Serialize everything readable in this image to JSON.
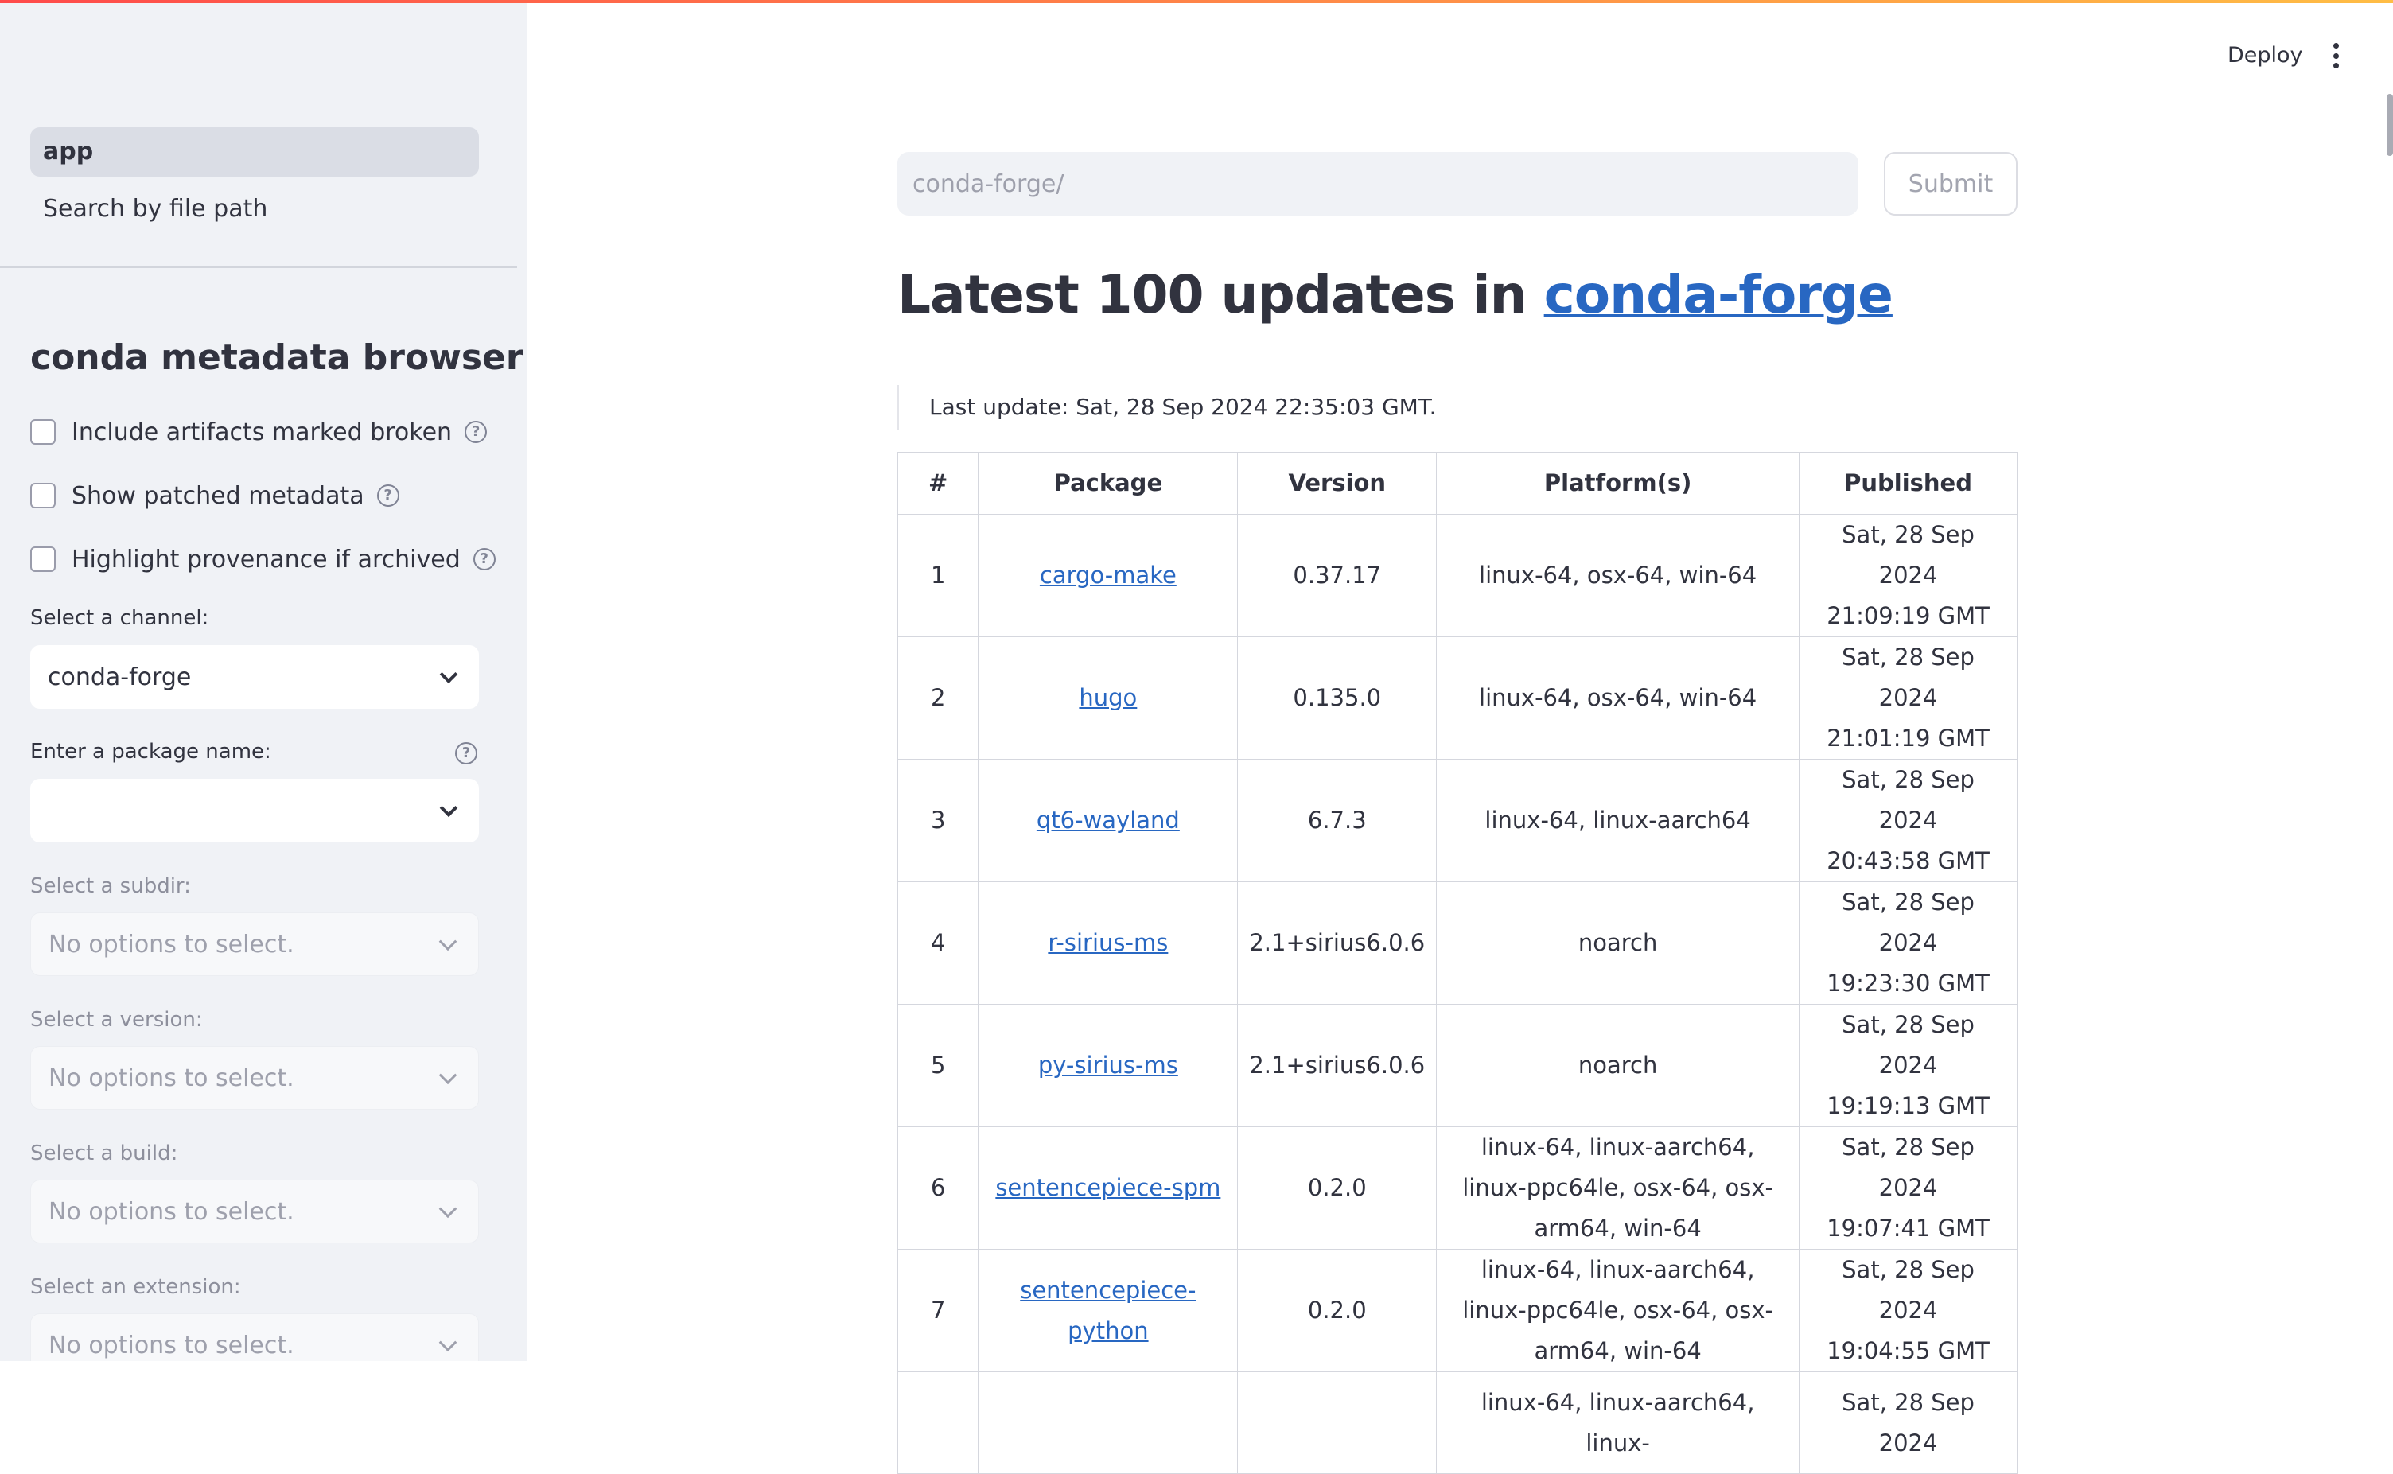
{
  "sidebar": {
    "nav": [
      {
        "label": "app",
        "active": true
      },
      {
        "label": "Search by file path",
        "active": false
      }
    ],
    "title": "conda metadata browser",
    "checkboxes": [
      {
        "label": "Include artifacts marked broken",
        "checked": false
      },
      {
        "label": "Show patched metadata",
        "checked": false
      },
      {
        "label": "Highlight provenance if archived",
        "checked": false
      }
    ],
    "channel": {
      "label": "Select a channel:",
      "value": "conda-forge"
    },
    "package": {
      "label": "Enter a package name:",
      "value": ""
    },
    "subdir": {
      "label": "Select a subdir:",
      "value": "No options to select."
    },
    "version": {
      "label": "Select a version:",
      "value": "No options to select."
    },
    "build": {
      "label": "Select a build:",
      "value": "No options to select."
    },
    "extension": {
      "label": "Select an extension:",
      "value": "No options to select."
    }
  },
  "header": {
    "deploy_label": "Deploy",
    "menu_icon": "kebab-menu-icon"
  },
  "main": {
    "search": {
      "placeholder": "conda-forge/",
      "value": ""
    },
    "submit_label": "Submit",
    "heading_prefix": "Latest 100 updates in",
    "heading_link": "conda-forge",
    "last_update": "Last update: Sat, 28 Sep 2024 22:35:03 GMT.",
    "table": {
      "columns": [
        "#",
        "Package",
        "Version",
        "Platform(s)",
        "Published"
      ],
      "rows": [
        {
          "num": "1",
          "package": "cargo-make",
          "version": "0.37.17",
          "platforms": "linux-64, osx-64, win-64",
          "published_date": "Sat, 28 Sep 2024",
          "published_time": "21:09:19 GMT"
        },
        {
          "num": "2",
          "package": "hugo",
          "version": "0.135.0",
          "platforms": "linux-64, osx-64, win-64",
          "published_date": "Sat, 28 Sep 2024",
          "published_time": "21:01:19 GMT"
        },
        {
          "num": "3",
          "package": "qt6-wayland",
          "version": "6.7.3",
          "platforms": "linux-64, linux-aarch64",
          "published_date": "Sat, 28 Sep 2024",
          "published_time": "20:43:58 GMT"
        },
        {
          "num": "4",
          "package": "r-sirius-ms",
          "version": "2.1+sirius6.0.6",
          "platforms": "noarch",
          "published_date": "Sat, 28 Sep 2024",
          "published_time": "19:23:30 GMT"
        },
        {
          "num": "5",
          "package": "py-sirius-ms",
          "version": "2.1+sirius6.0.6",
          "platforms": "noarch",
          "published_date": "Sat, 28 Sep 2024",
          "published_time": "19:19:13 GMT"
        },
        {
          "num": "6",
          "package": "sentencepiece-spm",
          "version": "0.2.0",
          "platforms": "linux-64, linux-aarch64, linux-ppc64le, osx-64, osx-arm64, win-64",
          "published_date": "Sat, 28 Sep 2024",
          "published_time": "19:07:41 GMT"
        },
        {
          "num": "7",
          "package": "sentencepiece-python",
          "version": "0.2.0",
          "platforms": "linux-64, linux-aarch64, linux-ppc64le, osx-64, osx-arm64, win-64",
          "published_date": "Sat, 28 Sep 2024",
          "published_time": "19:04:55 GMT"
        },
        {
          "num": "",
          "package": "",
          "version": "",
          "platforms": "linux-64, linux-aarch64, linux-",
          "published_date": "Sat, 28 Sep 2024",
          "published_time": ""
        }
      ]
    }
  },
  "colors": {
    "accent_link": "#2867c2",
    "sidebar_bg": "#f0f2f6",
    "text": "#31333f",
    "top_gradient_start": "#ff4b4b",
    "top_gradient_end": "#ffbd45"
  }
}
